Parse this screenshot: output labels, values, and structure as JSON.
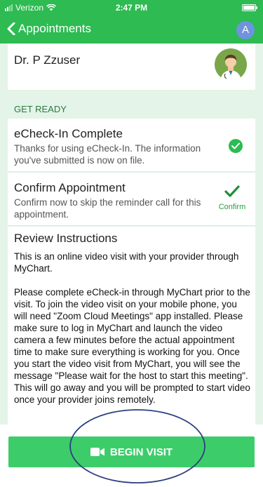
{
  "status_bar": {
    "carrier": "Verizon",
    "time": "2:47 PM"
  },
  "nav": {
    "back_label": "Appointments",
    "user_initial": "A"
  },
  "provider": {
    "name": "Dr. P Zzuser"
  },
  "section": {
    "title": "GET READY"
  },
  "tasks": [
    {
      "title": "eCheck-In Complete",
      "description": "Thanks for using eCheck-In. The information you've submitted is now on file."
    },
    {
      "title": "Confirm Appointment",
      "description": "Confirm now to skip the reminder call for this appointment.",
      "action_label": "Confirm"
    }
  ],
  "review": {
    "title": "Review Instructions",
    "paragraphs": [
      "This is an online video visit with your provider through MyChart.",
      "Please complete eCheck-in through MyChart prior to the visit. To join the video visit on your mobile phone, you will need \"Zoom Cloud Meetings\" app installed. Please make sure to log in MyChart and launch the video camera a few minutes before the actual appointment time to make sure everything is working for you. Once you start the video visit from MyChart, you will see the message \"Please wait for the host to start this meeting\". This will go away and you will be prompted to start video once your provider joins remotely."
    ]
  },
  "action": {
    "begin_label": "BEGIN VISIT"
  },
  "colors": {
    "brand_green": "#2dbb52",
    "button_green": "#3ccd6a",
    "page_tint": "#e4f4e8",
    "annotation": "#2c3f80"
  }
}
